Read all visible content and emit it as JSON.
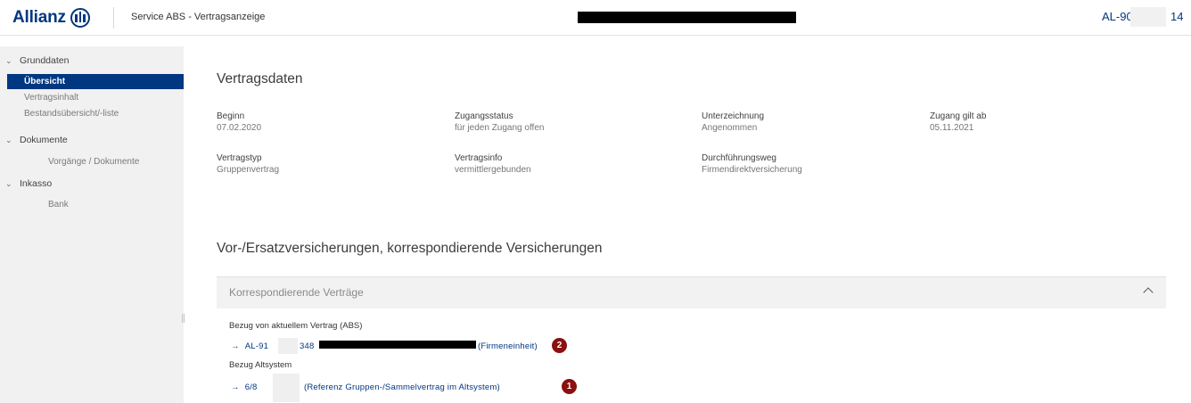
{
  "header": {
    "brand": "Allianz",
    "app_title": "Service ABS - Vertragsanzeige",
    "contract_id_prefix": "AL-906",
    "contract_id_suffix": "14"
  },
  "sidebar": {
    "groups": [
      {
        "label": "Grunddaten",
        "items": [
          "Übersicht",
          "Vertragsinhalt",
          "Bestandsübersicht/-liste"
        ]
      },
      {
        "label": "Dokumente",
        "items": [
          "Vorgänge / Dokumente"
        ]
      },
      {
        "label": "Inkasso",
        "items": [
          "Bank"
        ]
      }
    ],
    "active_item": "Übersicht"
  },
  "main": {
    "section_title": "Vertragsdaten",
    "fields": [
      {
        "label": "Beginn",
        "value": "07.02.2020"
      },
      {
        "label": "Zugangsstatus",
        "value": "für jeden Zugang offen"
      },
      {
        "label": "Unterzeichnung",
        "value": "Angenommen"
      },
      {
        "label": "Zugang gilt ab",
        "value": "05.11.2021"
      },
      {
        "label": "Vertragstyp",
        "value": "Gruppenvertrag"
      },
      {
        "label": "Vertragsinfo",
        "value": "vermittlergebunden"
      },
      {
        "label": "Durchführungsweg",
        "value": "Firmendirektversicherung"
      }
    ],
    "insurance_title": "Vor-/Ersatzversicherungen, korrespondierende Versicherungen",
    "accordion": {
      "title": "Korrespondierende Verträge",
      "expanded": true
    },
    "references": {
      "current_label": "Bezug von aktuellem Vertrag (ABS)",
      "current_arrow": "→",
      "current_prefix": "AL-91",
      "current_mid": "348",
      "current_suffix": "(Firmeneinheit)",
      "current_badge": "2",
      "legacy_label": "Bezug Altsystem",
      "legacy_arrow": "→",
      "legacy_prefix": "6/8",
      "legacy_suffix": "(Referenz Gruppen-/Sammelvertrag im Altsystem)",
      "legacy_badge": "1"
    }
  },
  "colors": {
    "brand": "#003781",
    "badge": "#8b1010",
    "sidebar_bg": "#f1f1f1"
  },
  "icons": [
    "allianz-logo-icon",
    "chevron-down-icon",
    "chevron-up-icon",
    "arrow-right-icon"
  ]
}
